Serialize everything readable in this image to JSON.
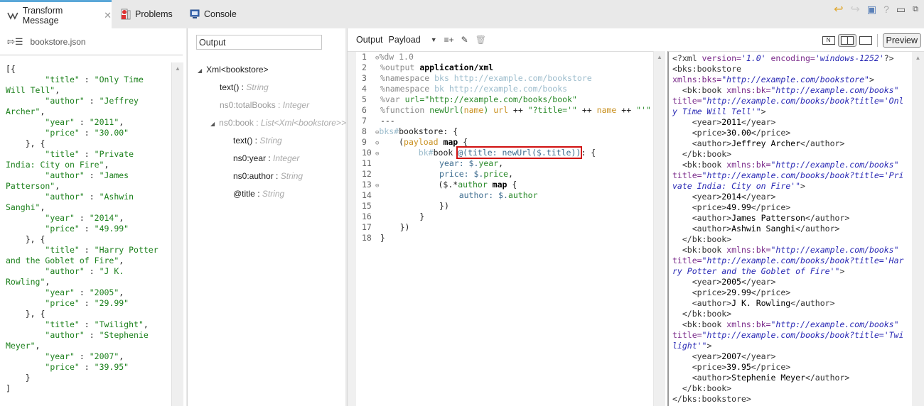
{
  "tabs": [
    {
      "label": "Transform Message",
      "icon": "transform-icon",
      "active": true
    },
    {
      "label": "Problems",
      "icon": "problems-icon"
    },
    {
      "label": "Console",
      "icon": "console-icon"
    }
  ],
  "window_icons": [
    "undo-icon",
    "redo-icon",
    "save-icon",
    "help-icon",
    "minimize-icon",
    "restore-icon"
  ],
  "source": {
    "filename": "bookstore.json",
    "json_lines": [
      "[{",
      "        \"title\" : \"Only Time Will Tell\",",
      "        \"author\" : \"Jeffrey Archer\",",
      "        \"year\" : \"2011\",",
      "        \"price\" : \"30.00\"",
      "    }, {",
      "        \"title\" : \"Private India: City on Fire\",",
      "        \"author\" : \"James Patterson\",",
      "        \"author\" : \"Ashwin Sanghi\",",
      "        \"year\" : \"2014\",",
      "        \"price\" : \"49.99\"",
      "    }, {",
      "        \"title\" : \"Harry Potter and the Goblet of Fire\",",
      "        \"author\" : \"J K. Rowling\",",
      "        \"year\" : \"2005\",",
      "        \"price\" : \"29.99\"",
      "    }, {",
      "        \"title\" : \"Twilight\",",
      "        \"author\" : \"Stephenie Meyer\",",
      "        \"year\" : \"2007\",",
      "        \"price\" : \"39.95\"",
      "    }",
      "]"
    ]
  },
  "tree": {
    "search_value": "Output",
    "items": [
      {
        "name": "Xml<bookstore>",
        "type": ""
      },
      {
        "name": "text()",
        "type": "String"
      },
      {
        "name": "ns0:totalBooks",
        "type": "Integer"
      },
      {
        "name": "ns0:book",
        "type": "List<Xml<bookstore>>"
      },
      {
        "name": "text()",
        "type": "String"
      },
      {
        "name": "ns0:year",
        "type": "Integer"
      },
      {
        "name": "ns0:author",
        "type": "String"
      },
      {
        "name": "@title",
        "type": "String"
      }
    ]
  },
  "editor": {
    "output_label": "Output",
    "payload_label": "Payload",
    "preview_label": "Preview",
    "line_numbers": [
      "1",
      "2",
      "3",
      "4",
      "5",
      "6",
      "7",
      "8",
      "9",
      "10",
      "11",
      "12",
      "13",
      "14",
      "15",
      "16",
      "17",
      "18"
    ],
    "code": {
      "l1": "%dw 1.0",
      "l2a": "%output ",
      "l2b": "application/xml",
      "l3a": "%namespace ",
      "l3b": "bks http://example.com/bookstore",
      "l4a": "%namespace ",
      "l4b": "bk http://example.com/books",
      "l5a": "%var ",
      "l5b": "url=",
      "l5c": "\"http://example.com/books/book\"",
      "l6a": "%function ",
      "l6b": "newUrl(",
      "l6c": "name",
      "l6d": ") ",
      "l6e": "url",
      "l6f": " ++ ",
      "l6g": "\"?title='\"",
      "l6h": " ++ ",
      "l6i": "name",
      "l6j": " ++ ",
      "l6k": "\"'\"",
      "l7": "---",
      "l8a": "bks#",
      "l8b": "bookstore: {",
      "l9a": "    (",
      "l9b": "payload",
      "l9c": " map",
      "l9d": " {",
      "l10a": "        bk#",
      "l10b": "book ",
      "l10c": "@(title: newUrl($.title))",
      "l10d": ": {",
      "l11a": "            year: $.",
      "l11b": "year",
      "l11c": ",",
      "l12a": "            price: $.",
      "l12b": "price",
      "l12c": ",",
      "l13a": "            ($.*",
      "l13b": "author",
      "l13c": " map",
      "l13d": " {",
      "l14a": "                author: $.",
      "l14b": "author",
      "l15": "            })",
      "l16": "        }",
      "l17": "    })",
      "l18": "}"
    }
  },
  "preview": {
    "xml_decl": [
      "<?xml ",
      "version=",
      "'1.0'",
      " encoding=",
      "'windows-1252'",
      "?>"
    ],
    "root_open": "<bks:bookstore",
    "root_ns_attr": "xmlns:bks=",
    "root_ns_val": "\"http://example.com/bookstore\"",
    "book_open": "<bk:book ",
    "book_ns_attr": "xmlns:bk=",
    "book_ns_val": "\"http://example.com/books\"",
    "title_attr": "title=",
    "book_close": "</bk:book>",
    "root_close": "</bks:bookstore>",
    "books": [
      {
        "title_url": "\"http://example.com/books/book?title='Only Time Will Tell'\"",
        "year": "2011",
        "price": "30.00",
        "authors": [
          "Jeffrey Archer"
        ]
      },
      {
        "title_url": "\"http://example.com/books/book?title='Private India: City on Fire'\"",
        "year": "2014",
        "price": "49.99",
        "authors": [
          "James Patterson",
          "Ashwin Sanghi"
        ]
      },
      {
        "title_url": "\"http://example.com/books/book?title='Harry Potter and the Goblet of Fire'\"",
        "year": "2005",
        "price": "29.99",
        "authors": [
          "J K. Rowling"
        ]
      },
      {
        "title_url": "\"http://example.com/books/book?title='Twilight'\"",
        "year": "2007",
        "price": "39.95",
        "authors": [
          "Stephenie Meyer"
        ]
      }
    ]
  }
}
